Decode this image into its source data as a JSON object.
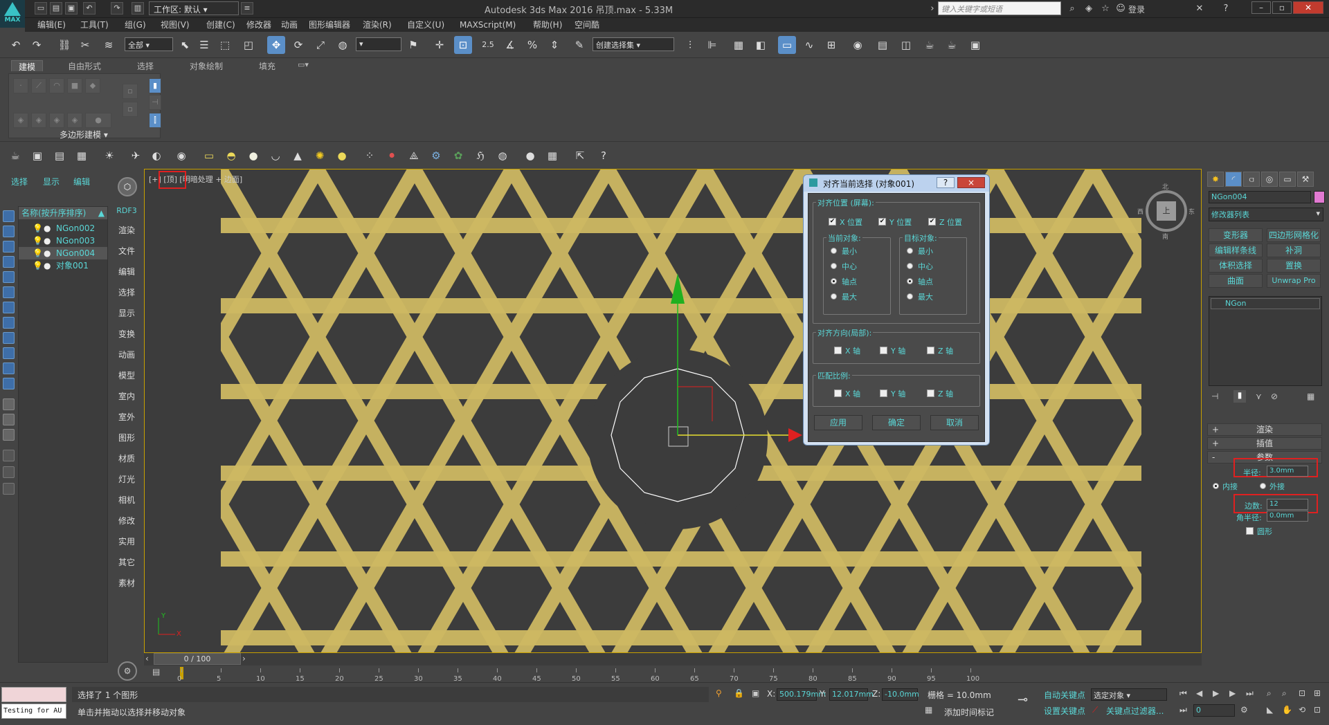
{
  "titlebar": {
    "app_logo_text": "MAX",
    "workspace": "工作区: 默认",
    "title": "Autodesk 3ds Max 2016      吊顶.max - 5.33M",
    "search_placeholder": "键入关键字或短语",
    "login": "登录"
  },
  "menubar": [
    "编辑(E)",
    "工具(T)",
    "组(G)",
    "视图(V)",
    "创建(C)",
    "修改器",
    "动画",
    "图形编辑器",
    "渲染(R)",
    "自定义(U)",
    "MAXScript(M)",
    "帮助(H)",
    "空间酷"
  ],
  "maintool": {
    "filter_value": "全部",
    "snap_value": "2.5",
    "named_selection": "创建选择集"
  },
  "ribbon": {
    "tabs": [
      "建模",
      "自由形式",
      "选择",
      "对象绘制",
      "填充"
    ],
    "panel_label": "多边形建模"
  },
  "explorer": {
    "tabs": [
      "选择",
      "显示",
      "编辑"
    ],
    "column_header": "名称(按升序排序)",
    "rows": [
      "NGon002",
      "NGon003",
      "NGon004",
      "对象001"
    ]
  },
  "vtoolbar": {
    "rdf_label": "RDF3",
    "items": [
      "渲染",
      "文件",
      "编辑",
      "选择",
      "显示",
      "变换",
      "动画",
      "模型",
      "室内",
      "室外",
      "图形",
      "材质",
      "灯光",
      "相机",
      "修改",
      "实用",
      "其它",
      "素材"
    ]
  },
  "viewport": {
    "label_prefix": "[+]",
    "label_view": "[顶]",
    "label_shading": "[明暗处理 + 边面]",
    "viewcube_label": "上",
    "viewcube_n": "北",
    "viewcube_s": "南",
    "viewcube_w": "西",
    "viewcube_e": "东",
    "axis_x": "X",
    "axis_y": "Y"
  },
  "dialog": {
    "title": "对齐当前选择 (对象001)",
    "help": "?",
    "close": "×",
    "align_position_group": "对齐位置 (屏幕):",
    "x_pos": "X 位置",
    "y_pos": "Y 位置",
    "z_pos": "Z 位置",
    "current_object": "当前对象:",
    "target_object": "目标对象:",
    "options": [
      "最小",
      "中心",
      "轴点",
      "最大"
    ],
    "align_orientation_group": "对齐方向(局部):",
    "match_scale_group": "匹配比例:",
    "x_axis": "X 轴",
    "y_axis": "Y 轴",
    "z_axis": "Z 轴",
    "apply": "应用",
    "ok": "确定",
    "cancel": "取消"
  },
  "cmdpanel": {
    "object_name": "NGon004",
    "modifier_list": "修改器列表",
    "buttons": [
      "变形器",
      "四边形网格化",
      "编辑样条线",
      "补洞",
      "体积选择",
      "置换",
      "曲面",
      "Unwrap Pro"
    ],
    "stack_item": "NGon",
    "rollouts": {
      "render": "渲染",
      "interp": "插值",
      "params": "参数"
    },
    "radius_label": "半径:",
    "radius_value": "3.0mm",
    "inscribed": "内接",
    "circumscribed": "外接",
    "sides_label": "边数:",
    "sides_value": "12",
    "corner_label": "角半径:",
    "corner_value": "0.0mm",
    "circular": "圆形"
  },
  "timeline": {
    "frame": "0 / 100",
    "ticks": [
      "0",
      "5",
      "10",
      "15",
      "20",
      "25",
      "30",
      "35",
      "40",
      "45",
      "50",
      "55",
      "60",
      "65",
      "70",
      "75",
      "80",
      "85",
      "90",
      "95",
      "100"
    ]
  },
  "status": {
    "script_label": "Testing for AU",
    "selected": "选择了 1 个图形",
    "prompt": "单击并拖动以选择并移动对象",
    "x_label": "X:",
    "x_value": "500.179mm",
    "y_label": "Y:",
    "y_value": "12.017mm",
    "z_label": "Z:",
    "z_value": "-10.0mm",
    "grid": "栅格 = 10.0mm",
    "auto_key": "自动关键点",
    "set_key": "设置关键点",
    "selected_obj": "选定对象",
    "key_filters": "关键点过滤器...",
    "add_time_tag": "添加时间标记",
    "frame_field": "0"
  },
  "colors": {
    "accent": "#5ad7d7",
    "viewport_border": "#c8a000",
    "highlight_red": "#e02020",
    "gold": "#cdb862"
  }
}
